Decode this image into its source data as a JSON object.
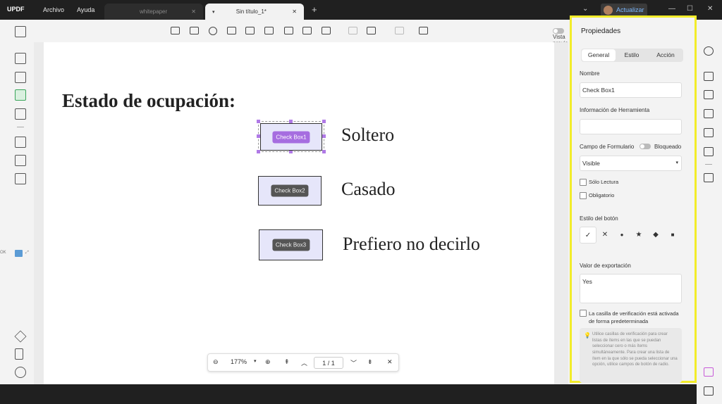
{
  "app": {
    "logo": "UPDF",
    "menu": [
      "Archivo",
      "Ayuda"
    ]
  },
  "tabs": [
    {
      "label": "whitepaper",
      "active": false
    },
    {
      "label": "Sin título_1*",
      "active": true
    }
  ],
  "window": {
    "upgrade_label": "Actualizar",
    "chevron": "⌄",
    "minimize": "—",
    "maximize": "☐",
    "close": "✕"
  },
  "toolbar": {
    "preview_label": "Vista previa"
  },
  "document": {
    "heading": "Estado de ocupación:",
    "checkboxes": [
      {
        "tag": "Check Box1",
        "label": "Soltero"
      },
      {
        "tag": "Check Box2",
        "label": "Casado"
      },
      {
        "tag": "Check Box3",
        "label": "Prefiero no decirlo"
      }
    ]
  },
  "zoom": {
    "level": "177%",
    "page": "1 / 1"
  },
  "left_edge_tag": "OK",
  "properties": {
    "title": "Propiedades",
    "tabs": [
      "General",
      "Estilo",
      "Acción"
    ],
    "name_label": "Nombre",
    "name_value": "Check Box1",
    "tooltip_label": "Información de Herramienta",
    "tooltip_value": "",
    "form_field_label": "Campo de Formulario",
    "locked_label": "Bloqueado",
    "visibility": "Visible",
    "readonly_label": "Sólo Lectura",
    "required_label": "Obligatorio",
    "button_style_label": "Estilo del botón",
    "styles": [
      "✓",
      "✕",
      "●",
      "★",
      "◆",
      "■"
    ],
    "export_label": "Valor de exportación",
    "export_value": "Yes",
    "default_checked_label": "La casilla de verificación está activada de forma predeterminada",
    "note": "Utilice casillas de verificación para crear listas de ítems en las que se puedan seleccionar cero o más ítems simultáneamente. Para crear una lista de ítem en la que sólo se pueda seleccionar una opción, utilice campos de botón de radio."
  },
  "colors": {
    "accent": "#a66de0",
    "highlight": "#f2ec2a",
    "active_tool": "#3aa55a"
  }
}
